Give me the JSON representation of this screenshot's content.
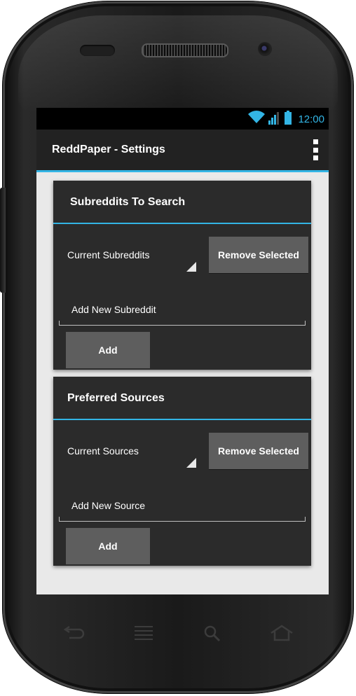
{
  "status_bar": {
    "time": "12:00",
    "icons": [
      "wifi-icon",
      "signal-icon",
      "battery-icon"
    ],
    "accent_color": "#33b5e5"
  },
  "action_bar": {
    "title": "ReddPaper - Settings",
    "overflow_icon": "overflow-menu-icon"
  },
  "subreddits_card": {
    "title": "Subreddits To Search",
    "spinner_label": "Current Subreddits",
    "remove_label": "Remove Selected",
    "input_placeholder": "Add New Subreddit",
    "add_label": "Add"
  },
  "sources_card": {
    "title": "Preferred Sources",
    "spinner_label": "Current Sources",
    "remove_label": "Remove Selected",
    "input_placeholder": "Add New Source",
    "add_label": "Add"
  },
  "nav_keys": [
    "back-icon",
    "menu-icon",
    "search-icon",
    "home-icon"
  ],
  "colors": {
    "accent": "#33b5e5",
    "card_background": "#2b2b2b",
    "button_background": "#5e5e5e",
    "screen_background": "#e9e9e9"
  }
}
